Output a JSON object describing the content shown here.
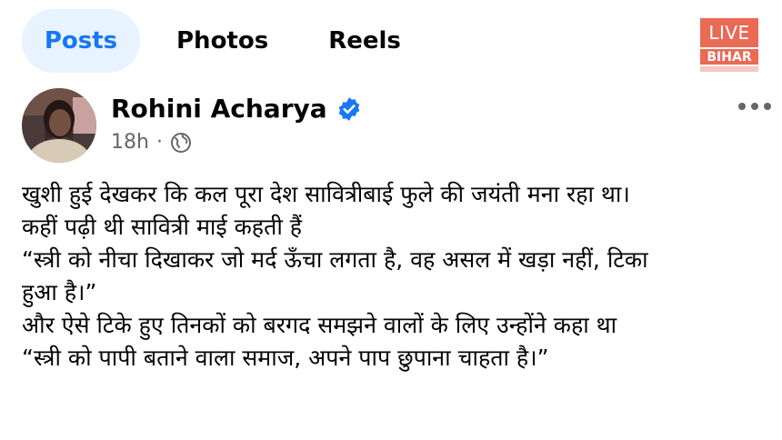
{
  "tabs": [
    {
      "label": "Posts",
      "active": true
    },
    {
      "label": "Photos",
      "active": false
    },
    {
      "label": "Reels",
      "active": false
    }
  ],
  "watermark": {
    "live": "LIVE",
    "region": "BIHAR"
  },
  "post": {
    "author": "Rohini Acharya",
    "verified_icon": "verified-badge-icon",
    "time": "18h",
    "separator": "·",
    "audience_icon": "globe-icon",
    "lines": [
      "खुशी हुई देखकर कि कल पूरा देश सावित्रीबाई फुले की जयंती मना रहा था।",
      "कहीं पढ़ी थी सावित्री माई कहती हैं",
      "“स्त्री को नीचा दिखाकर जो मर्द ऊँचा लगता है, वह असल में खड़ा नहीं, टिका",
      "हुआ है।”",
      "और ऐसे टिके हुए तिनकों को बरगद समझने वालों के लिए उन्होंने कहा था",
      "“स्त्री को पापी बताने वाला समाज, अपने पाप छुपाना चाहता है।”"
    ]
  },
  "colors": {
    "accent": "#1877f2",
    "active_tab_bg": "#e7f3ff",
    "muted": "#65676b",
    "logo": "#e96a55"
  }
}
